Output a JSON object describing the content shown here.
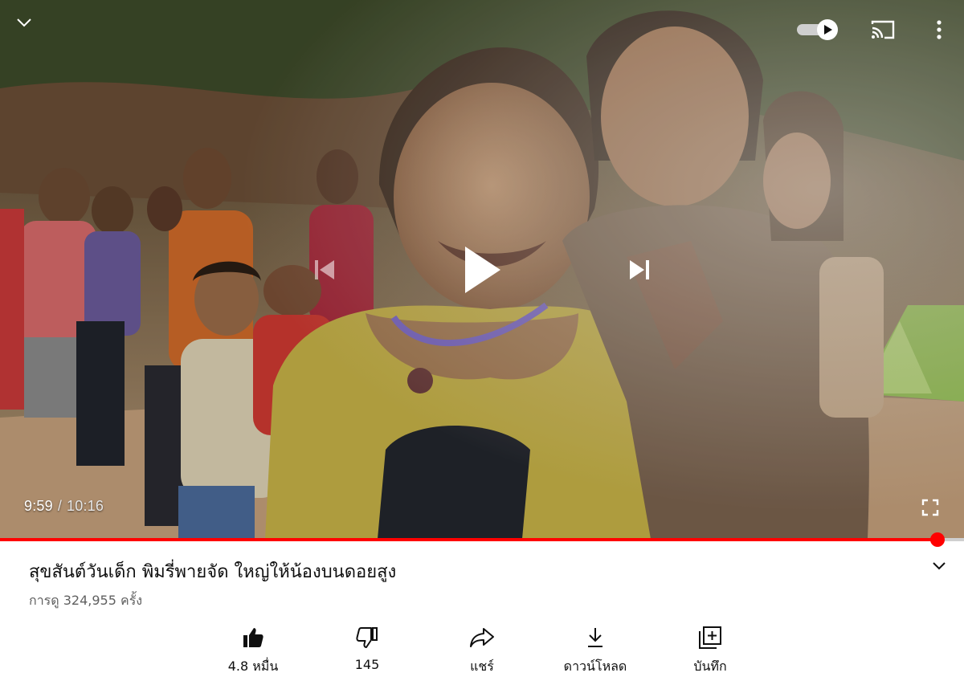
{
  "player": {
    "current_time": "9:59",
    "separator": "/",
    "duration": "10:16",
    "progress_fraction": 0.9724,
    "autoplay_on": true,
    "controls": {
      "collapse": "chevron-down-icon",
      "autoplay": "autoplay-toggle-icon",
      "cast": "cast-icon",
      "more": "more-vertical-icon",
      "previous": "skip-previous-icon",
      "play": "play-icon",
      "next": "skip-next-icon",
      "fullscreen": "fullscreen-icon"
    }
  },
  "video": {
    "title": "สุขสันต์วันเด็ก พิมรี่พายจัด ใหญ่ให้น้องบนดอยสูง",
    "views": "การดู 324,955 ครั้ง"
  },
  "actions": [
    {
      "icon": "thumbs-up-icon",
      "label": "4.8 หมื่น"
    },
    {
      "icon": "thumbs-down-icon",
      "label": "145"
    },
    {
      "icon": "share-icon",
      "label": "แชร์"
    },
    {
      "icon": "download-icon",
      "label": "ดาวน์โหลด"
    },
    {
      "icon": "save-playlist-icon",
      "label": "บันทึก"
    }
  ],
  "colors": {
    "progress": "#ff0000",
    "track": "#cfcfcf",
    "text_primary": "#0f0f0f",
    "text_secondary": "#606060"
  }
}
